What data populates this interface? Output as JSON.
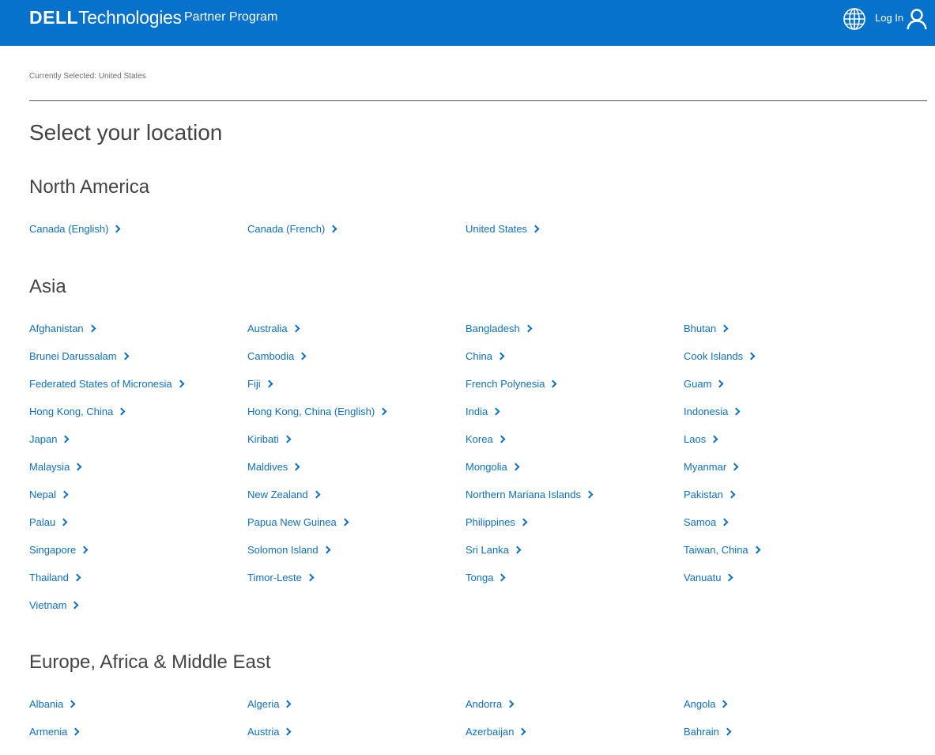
{
  "header": {
    "logo_bold": "DELL",
    "logo_light": "Technologies",
    "program": "Partner Program",
    "login_label": "Log In",
    "bg_color": "#0672cb"
  },
  "currently_selected": "Currently Selected: United States",
  "page_title": "Select your location",
  "link_color": "#0e70c0",
  "icons": {
    "globe": "globe-icon",
    "user": "user-icon",
    "chevron": "chevron-right-icon"
  },
  "regions": [
    {
      "title": "North America",
      "locations": [
        "Canada (English)",
        "Canada (French)",
        "United States"
      ]
    },
    {
      "title": "Asia",
      "locations": [
        "Afghanistan",
        "Australia",
        "Bangladesh",
        "Bhutan",
        "Brunei Darussalam",
        "Cambodia",
        "China",
        "Cook Islands",
        "Federated States of Micronesia",
        "Fiji",
        "French Polynesia",
        "Guam",
        "Hong Kong, China",
        "Hong Kong, China (English)",
        "India",
        "Indonesia",
        "Japan",
        "Kiribati",
        "Korea",
        "Laos",
        "Malaysia",
        "Maldives",
        "Mongolia",
        "Myanmar",
        "Nepal",
        "New Zealand",
        "Northern Mariana Islands",
        "Pakistan",
        "Palau",
        "Papua New Guinea",
        "Philippines",
        "Samoa",
        "Singapore",
        "Solomon Island",
        "Sri Lanka",
        "Taiwan, China",
        "Thailand",
        "Timor-Leste",
        "Tonga",
        "Vanuatu",
        "Vietnam"
      ]
    },
    {
      "title": "Europe, Africa & Middle East",
      "locations": [
        "Albania",
        "Algeria",
        "Andorra",
        "Angola",
        "Armenia",
        "Austria",
        "Azerbaijan",
        "Bahrain"
      ]
    }
  ]
}
